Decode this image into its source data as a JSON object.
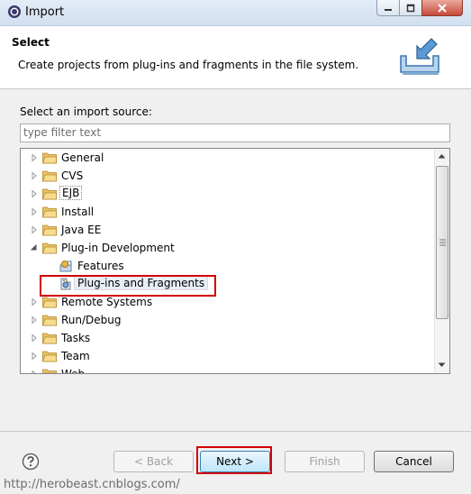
{
  "window": {
    "title": "Import"
  },
  "header": {
    "title": "Select",
    "description": "Create projects from plug-ins and fragments in the file system."
  },
  "source_label": "Select an import source:",
  "filter": {
    "placeholder": "type filter text",
    "value": ""
  },
  "tree": {
    "items": [
      {
        "label": "General",
        "type": "folder",
        "expanded": false
      },
      {
        "label": "CVS",
        "type": "folder",
        "expanded": false
      },
      {
        "label": "EJB",
        "type": "folder",
        "expanded": false
      },
      {
        "label": "Install",
        "type": "folder",
        "expanded": false
      },
      {
        "label": "Java EE",
        "type": "folder",
        "expanded": false
      },
      {
        "label": "Plug-in Development",
        "type": "folder",
        "expanded": true
      },
      {
        "label": "Features",
        "type": "child",
        "icon": "feature-icon"
      },
      {
        "label": "Plug-ins and Fragments",
        "type": "child",
        "icon": "plugin-icon",
        "selected": true
      },
      {
        "label": "Remote Systems",
        "type": "folder",
        "expanded": false
      },
      {
        "label": "Run/Debug",
        "type": "folder",
        "expanded": false
      },
      {
        "label": "Tasks",
        "type": "folder",
        "expanded": false
      },
      {
        "label": "Team",
        "type": "folder",
        "expanded": false
      },
      {
        "label": "Web",
        "type": "folder",
        "expanded": false
      }
    ]
  },
  "buttons": {
    "back": "< Back",
    "next": "Next >",
    "finish": "Finish",
    "cancel": "Cancel"
  },
  "watermark": "http://herobeast.cnblogs.com/",
  "colors": {
    "highlight_box": "#d20000",
    "selection_bg": "#e8eef7",
    "next_button": "#bee6fd"
  }
}
